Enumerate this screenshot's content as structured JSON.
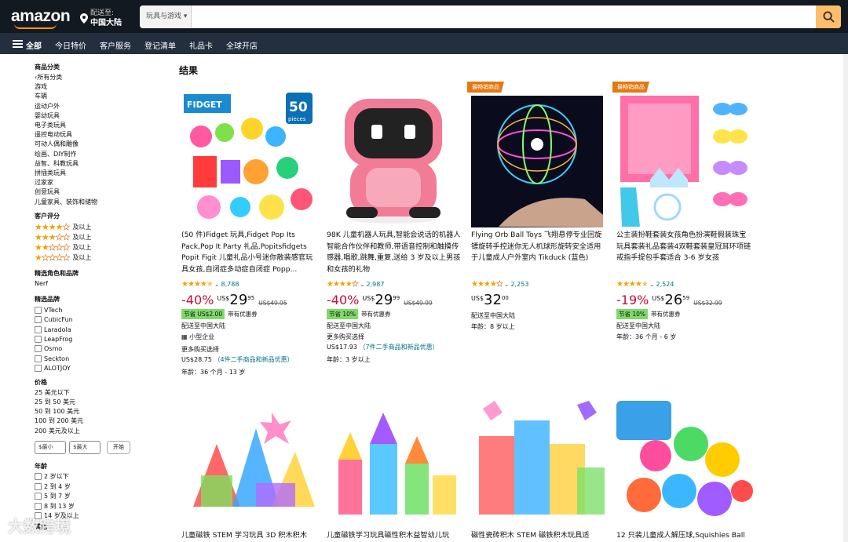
{
  "header": {
    "logo": "amazon",
    "deliver_line1": "配送至:",
    "deliver_line2": "中国大陆",
    "search_category": "玩具与游戏",
    "search_value": "",
    "search_placeholder": ""
  },
  "nav": {
    "all": "全部",
    "items": [
      "今日特价",
      "客户服务",
      "登记清单",
      "礼品卡",
      "全球开店"
    ]
  },
  "sidebar": {
    "cat_heading": "商品分类",
    "back_all": "所有分类",
    "categories": [
      "游戏",
      "车辆",
      "运动户外",
      "婴幼玩具",
      "电子类玩具",
      "遥控电动玩具",
      "可动人偶和雕像",
      "绘画、DIY制作",
      "益智、科教玩具",
      "拼插类玩具",
      "过家家",
      "创意玩具",
      "儿童家具、装饰和储物"
    ],
    "rating_heading": "客户评分",
    "rating_suffix": "及以上",
    "ratings": [
      4,
      3,
      2,
      1
    ],
    "role_heading": "精选角色和品牌",
    "role_items": [
      "Nerf"
    ],
    "brand_heading": "精选品牌",
    "brands": [
      "VTech",
      "CubicFun",
      "Laradola",
      "LeapFrog",
      "Osmo",
      "Seckton",
      "ALOTJOY"
    ],
    "price_heading": "价格",
    "price_ranges": [
      "25 美元以下",
      "25 到 50 美元",
      "50 到 100 美元",
      "100 到 200 美元",
      "200 美元及以上"
    ],
    "min_label": "$最小",
    "max_label": "$最大",
    "go_label": "开始",
    "age_heading": "年龄",
    "ages": [
      "2 岁以下",
      "2 到 4 岁",
      "5 到 7 岁",
      "8 到 13 岁",
      "14 岁及以上"
    ],
    "more_heading": "其他"
  },
  "results_title": "结果",
  "products": [
    {
      "badge": "",
      "title": "(50 件)Fidget 玩具,Fidget Pop Its Pack,Pop It Party 礼品,Popitsfidgets Popit Figit 儿童礼品小号迷你散装感官玩具女孩,自闭症多动症自闭症 Popp...",
      "stars": 4.5,
      "reviews": "8,788",
      "discount": "-40%",
      "currency": "US$",
      "whole": "29",
      "fraction": "95",
      "list_price": "US$49.95",
      "coupon": "节省 US$2.00",
      "coupon_note": "带有优惠券",
      "ship": "配送至中国大陆",
      "extra1": "小型企业",
      "extra2": "更多购买选择",
      "extra3_price": "US$28.75",
      "extra3_note": "（4件二手商品和新品优惠）",
      "age": "年龄：36 个月 - 13 岁"
    },
    {
      "badge": "",
      "title": "98K 儿童机器人玩具,智能会说话的机器人智能合作伙伴和教师,带语音控制和触摸传感器,唱歌,跳舞,重复,送给 3 岁及以上男孩和女孩的礼物",
      "stars": 4,
      "reviews": "2,987",
      "discount": "-40%",
      "currency": "US$",
      "whole": "29",
      "fraction": "99",
      "list_price": "US$49.99",
      "coupon": "节省 10%",
      "coupon_note": "带有优惠券",
      "ship": "配送至中国大陆",
      "extra1": "",
      "extra2": "更多购买选择",
      "extra3_price": "US$17.93",
      "extra3_note": "（7件二手商品和新品优惠）",
      "age": "年龄：3 岁以上"
    },
    {
      "badge": "最畅销商品",
      "title": "Flying Orb Ball Toys 飞翔悬停专业回旋镖旋转手控迷你无人机球形旋转安全适用于儿童成人户外室内 Tikduck (蓝色)",
      "stars": 4,
      "reviews": "2,253",
      "discount": "",
      "currency": "US$",
      "whole": "32",
      "fraction": "00",
      "list_price": "",
      "coupon": "",
      "coupon_note": "",
      "ship": "配送至中国大陆",
      "extra1": "",
      "extra2": "",
      "extra3_price": "",
      "extra3_note": "",
      "age": "年龄：8 岁以上"
    },
    {
      "badge": "最畅销商品",
      "title": "公主装扮鞋套装女孩角色扮演鞋假装珠宝玩具套装礼品套装4双鞋套装皇冠耳环项链戒指手提包手套适合 3-6 岁女孩",
      "stars": 4.5,
      "reviews": "2,524",
      "discount": "-19%",
      "currency": "US$",
      "whole": "26",
      "fraction": "59",
      "list_price": "US$32.99",
      "coupon": "节省 10%",
      "coupon_note": "带有优惠券",
      "ship": "配送至中国大陆",
      "extra1": "",
      "extra2": "",
      "extra3_price": "",
      "extra3_note": "",
      "age": "年龄：36 个月 - 6 岁"
    }
  ],
  "products_row2": [
    "儿童磁铁 STEM 学习玩具 3D 积木积木",
    "儿童磁铁学习玩具磁性积木益智幼儿玩",
    "磁性瓷砖积木 STEM 磁铁积木玩具适",
    "12 只装儿童成人解压球,Squishies Ball"
  ],
  "card1_fidget_text": "FIDGET",
  "card1_count": "50",
  "card1_pieces": "pieces",
  "watermark": "大数跨境",
  "colors": {
    "header": "#131921",
    "nav": "#232f3e",
    "search_button": "#febd69",
    "badge": "#e47911",
    "discount": "#cc0c39",
    "coupon": "#7fda69",
    "link": "#007185",
    "star": "#f59f00"
  }
}
